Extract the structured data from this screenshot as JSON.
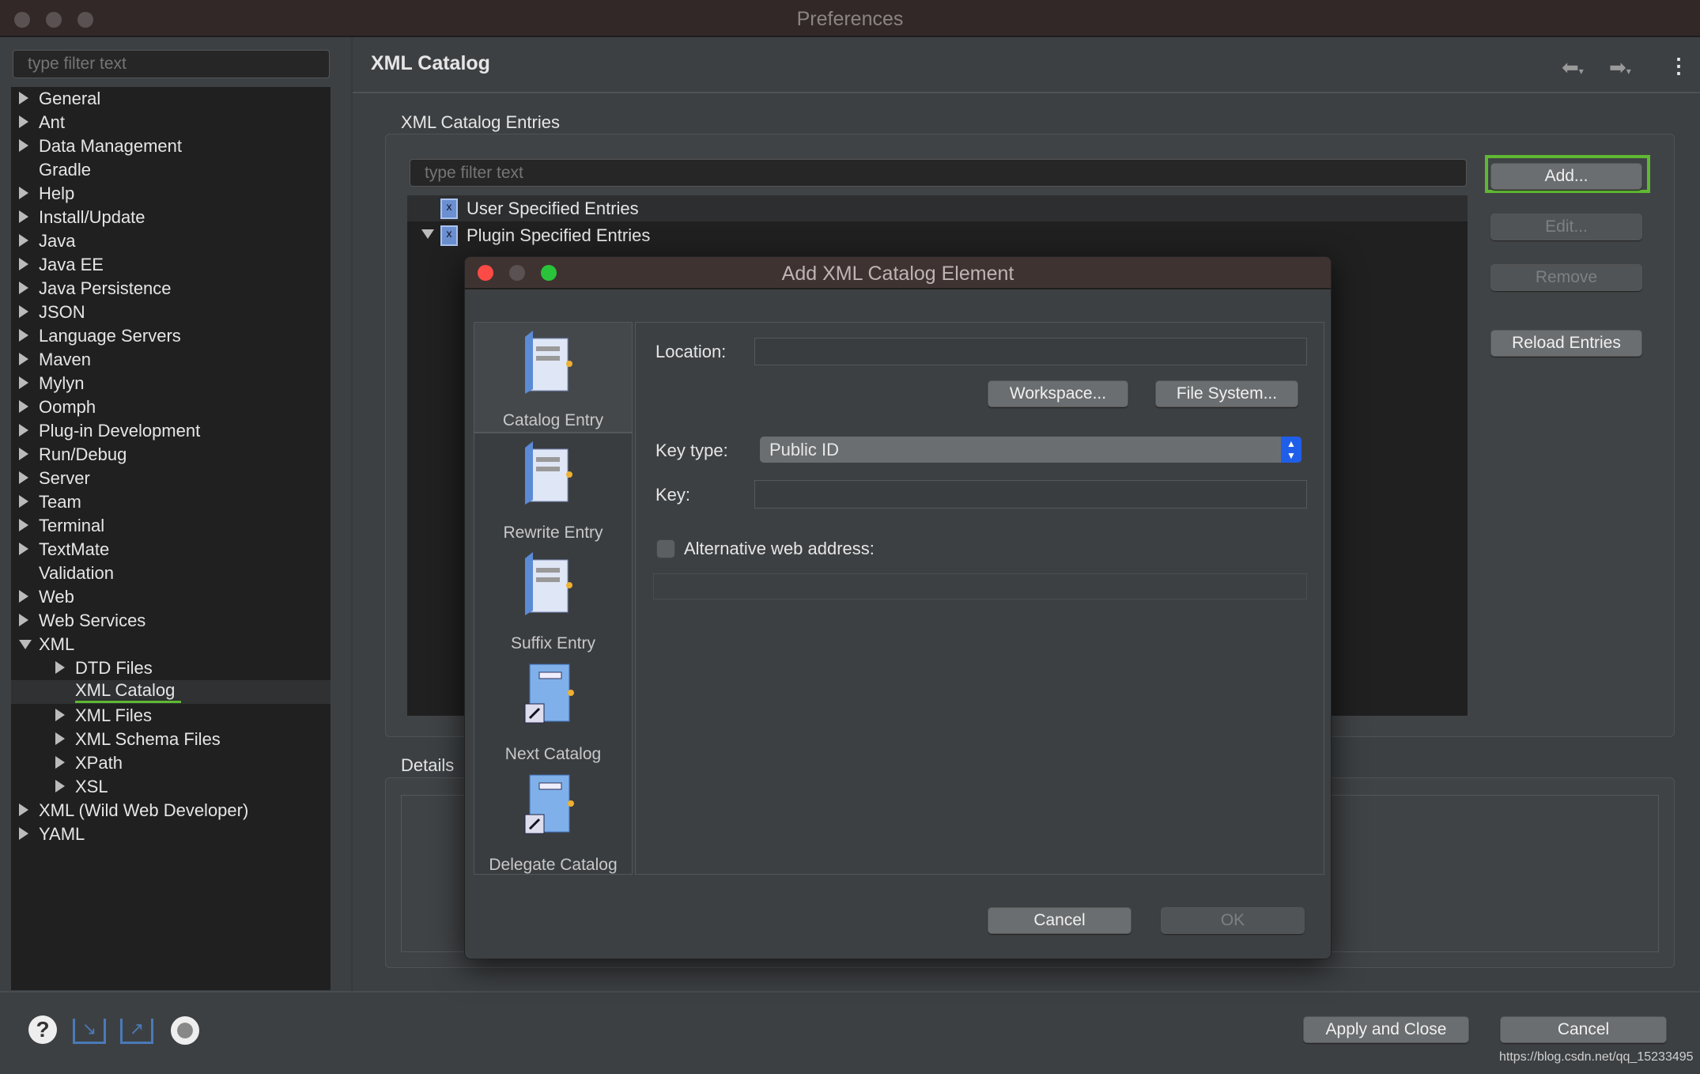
{
  "window": {
    "title": "Preferences"
  },
  "sidebar": {
    "filter_placeholder": "type filter text",
    "items": [
      {
        "label": "General",
        "level": 0,
        "arrow": "closed"
      },
      {
        "label": "Ant",
        "level": 0,
        "arrow": "closed"
      },
      {
        "label": "Data Management",
        "level": 0,
        "arrow": "closed"
      },
      {
        "label": "Gradle",
        "level": 0,
        "arrow": "none"
      },
      {
        "label": "Help",
        "level": 0,
        "arrow": "closed"
      },
      {
        "label": "Install/Update",
        "level": 0,
        "arrow": "closed"
      },
      {
        "label": "Java",
        "level": 0,
        "arrow": "closed"
      },
      {
        "label": "Java EE",
        "level": 0,
        "arrow": "closed"
      },
      {
        "label": "Java Persistence",
        "level": 0,
        "arrow": "closed"
      },
      {
        "label": "JSON",
        "level": 0,
        "arrow": "closed"
      },
      {
        "label": "Language Servers",
        "level": 0,
        "arrow": "closed"
      },
      {
        "label": "Maven",
        "level": 0,
        "arrow": "closed"
      },
      {
        "label": "Mylyn",
        "level": 0,
        "arrow": "closed"
      },
      {
        "label": "Oomph",
        "level": 0,
        "arrow": "closed"
      },
      {
        "label": "Plug-in Development",
        "level": 0,
        "arrow": "closed"
      },
      {
        "label": "Run/Debug",
        "level": 0,
        "arrow": "closed"
      },
      {
        "label": "Server",
        "level": 0,
        "arrow": "closed"
      },
      {
        "label": "Team",
        "level": 0,
        "arrow": "closed"
      },
      {
        "label": "Terminal",
        "level": 0,
        "arrow": "closed"
      },
      {
        "label": "TextMate",
        "level": 0,
        "arrow": "closed"
      },
      {
        "label": "Validation",
        "level": 0,
        "arrow": "none"
      },
      {
        "label": "Web",
        "level": 0,
        "arrow": "closed"
      },
      {
        "label": "Web Services",
        "level": 0,
        "arrow": "closed"
      },
      {
        "label": "XML",
        "level": 0,
        "arrow": "open"
      },
      {
        "label": "DTD Files",
        "level": 1,
        "arrow": "closed"
      },
      {
        "label": "XML Catalog",
        "level": 1,
        "arrow": "none",
        "selected": true
      },
      {
        "label": "XML Files",
        "level": 1,
        "arrow": "closed"
      },
      {
        "label": "XML Schema Files",
        "level": 1,
        "arrow": "closed"
      },
      {
        "label": "XPath",
        "level": 1,
        "arrow": "closed"
      },
      {
        "label": "XSL",
        "level": 1,
        "arrow": "closed"
      },
      {
        "label": "XML (Wild Web Developer)",
        "level": 0,
        "arrow": "closed"
      },
      {
        "label": "YAML",
        "level": 0,
        "arrow": "closed"
      }
    ]
  },
  "page": {
    "title": "XML Catalog",
    "entries_label": "XML Catalog Entries",
    "filter_placeholder": "type filter text",
    "entries": [
      "User Specified Entries",
      "Plugin Specified Entries"
    ],
    "buttons": {
      "add": "Add...",
      "edit": "Edit...",
      "remove": "Remove",
      "reload": "Reload Entries"
    },
    "details_label": "Details"
  },
  "footer": {
    "apply_close": "Apply and Close",
    "cancel": "Cancel",
    "watermark": "https://blog.csdn.net/qq_15233495"
  },
  "dialog": {
    "title": "Add XML Catalog Element",
    "types": [
      "Catalog Entry",
      "Rewrite Entry",
      "Suffix Entry",
      "Next Catalog",
      "Delegate Catalog"
    ],
    "selected_type": "Catalog Entry",
    "location_label": "Location:",
    "location_value": "",
    "workspace_button": "Workspace...",
    "filesystem_button": "File System...",
    "key_type_label": "Key type:",
    "key_type_value": "Public ID",
    "key_label": "Key:",
    "key_value": "",
    "alt_web_label": "Alternative web address:",
    "alt_web_checked": false,
    "alt_web_value": "",
    "cancel": "Cancel",
    "ok": "OK"
  },
  "colors": {
    "highlight_green": "#5fb832",
    "close_red": "#fc4b45",
    "zoom_green": "#2ac43a",
    "select_blue": "#1f5ee8"
  }
}
